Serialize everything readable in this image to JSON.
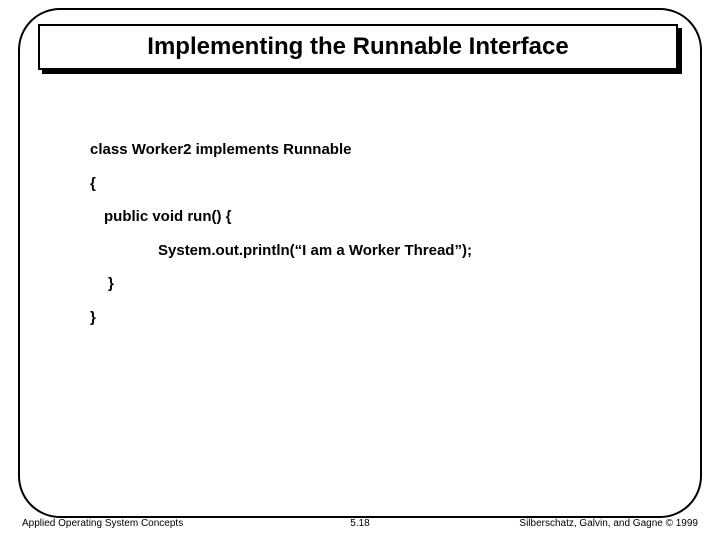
{
  "slide": {
    "title": "Implementing the Runnable Interface",
    "code": {
      "l1": "class  Worker2 implements Runnable",
      "l2": "{",
      "l3": "public void run() {",
      "l4": "System.out.println(“I am a Worker Thread”);",
      "l5": "}",
      "l6": "}"
    },
    "footer": {
      "left": "Applied Operating System Concepts",
      "center": "5.18",
      "right": "Silberschatz, Galvin, and Gagne © 1999"
    }
  }
}
